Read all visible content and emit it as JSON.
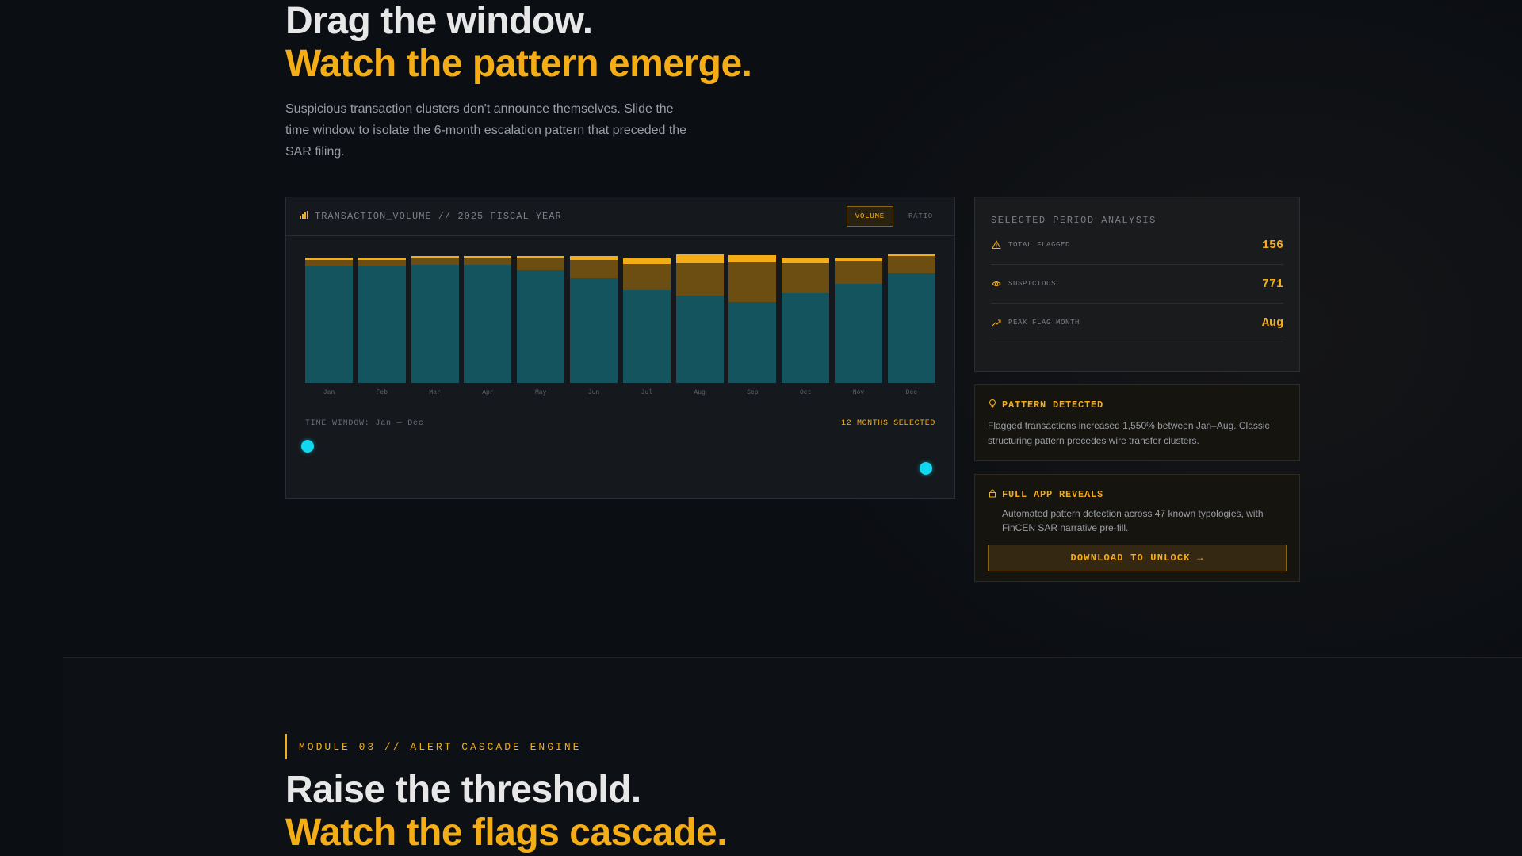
{
  "hero": {
    "title_line1": "Drag the window.",
    "title_line2": "Watch the pattern emerge.",
    "description": "Suspicious transaction clusters don't announce themselves. Slide the time window to isolate the 6-month escalation pattern that preceded the SAR filing."
  },
  "chart_panel": {
    "title": "TRANSACTION_VOLUME // 2025 FISCAL YEAR",
    "toggle_volume": "VOLUME",
    "toggle_ratio": "RATIO",
    "time_window_label": "TIME WINDOW: Jan — Dec",
    "months_selected": "12 MONTHS SELECTED"
  },
  "chart_data": {
    "type": "bar",
    "stacked": true,
    "categories": [
      "Jan",
      "Feb",
      "Mar",
      "Apr",
      "May",
      "Jun",
      "Jul",
      "Aug",
      "Sep",
      "Oct",
      "Nov",
      "Dec"
    ],
    "series": [
      {
        "values": [
          148,
          148,
          149,
          149,
          142,
          132,
          117,
          110,
          102,
          113,
          125,
          138
        ]
      },
      {
        "values": [
          7,
          7,
          9,
          9,
          16,
          23,
          33,
          41,
          50,
          38,
          29,
          22
        ]
      },
      {
        "values": [
          3,
          3,
          2,
          2,
          2,
          5,
          7,
          11,
          9,
          6,
          3,
          2
        ]
      }
    ],
    "colors": [
      "#13545f",
      "#6d4e12",
      "#f5ad16"
    ],
    "ylim": [
      0,
      162
    ],
    "grid": false,
    "legend": "none"
  },
  "analysis": {
    "title": "SELECTED PERIOD ANALYSIS",
    "rows": [
      {
        "icon": "warning-icon",
        "label": "TOTAL FLAGGED",
        "value": "156"
      },
      {
        "icon": "eye-icon",
        "label": "SUSPICIOUS",
        "value": "771"
      },
      {
        "icon": "trend-up-icon",
        "label": "PEAK FLAG MONTH",
        "value": "Aug"
      }
    ]
  },
  "pattern": {
    "icon": "lightbulb-icon",
    "title": "PATTERN DETECTED",
    "text": "Flagged transactions increased 1,550% between Jan–Aug. Classic structuring pattern precedes wire transfer clusters."
  },
  "unlock": {
    "icon": "lock-icon",
    "title": "FULL APP REVEALS",
    "text": "Automated pattern detection across 47 known typologies, with FinCEN SAR narrative pre-fill.",
    "button": "DOWNLOAD TO UNLOCK →"
  },
  "module": {
    "tag": "MODULE 03 // ALERT CASCADE ENGINE",
    "title_line1": "Raise the threshold.",
    "title_line2": "Watch the flags cascade."
  },
  "colors": {
    "accent": "#f5ad16",
    "teal": "#13545f",
    "handle": "#10d8ee",
    "background": "#0b0e13"
  }
}
